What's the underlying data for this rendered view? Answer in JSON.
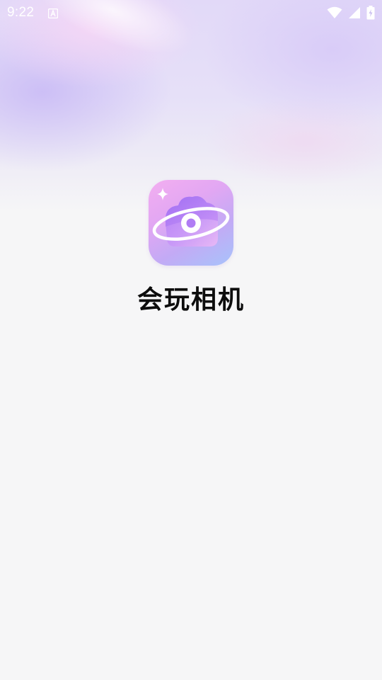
{
  "status_bar": {
    "time": "9:22",
    "icons": [
      "a-notification-icon",
      "wifi-icon",
      "signal-icon",
      "battery-icon"
    ]
  },
  "app": {
    "name": "会玩相机",
    "logo": "camera-planet-logo"
  },
  "colors": {
    "background": "#f6f6f7",
    "logo_pink": "#f3aef0",
    "logo_purple": "#b98af5",
    "logo_blue": "#a7c3fb",
    "title_text": "#0d0d0d"
  }
}
